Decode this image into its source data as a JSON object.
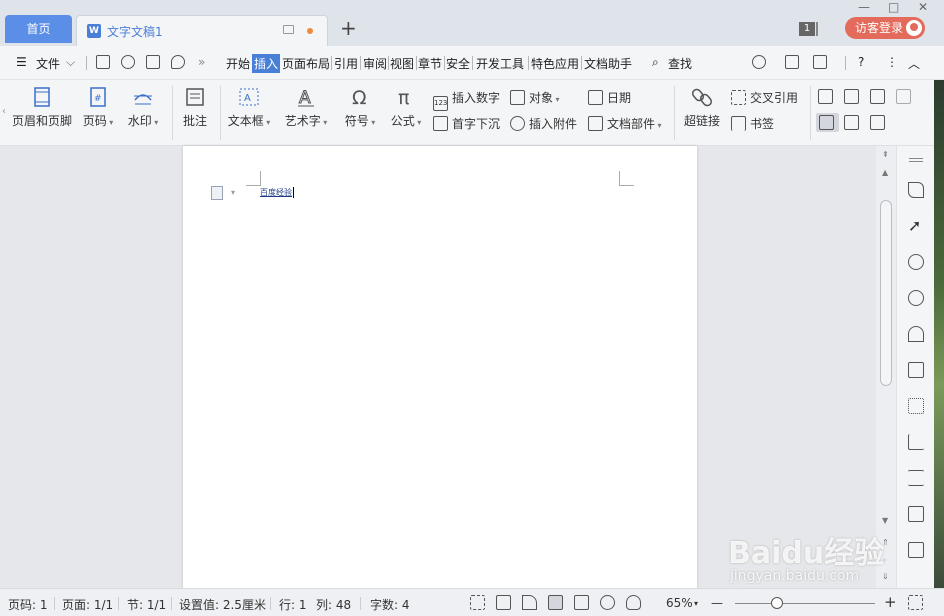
{
  "titlebar": {
    "home_tab": "首页",
    "doc_tab": "文字文稿1",
    "new_tab": "+",
    "minimize": "—",
    "restore": "□",
    "close": "✕",
    "badge": "1",
    "login": "访客登录"
  },
  "menubar": {
    "file": "文件",
    "more": "»",
    "tabs": [
      "开始",
      "插入",
      "页面布局",
      "引用",
      "审阅",
      "视图",
      "章节",
      "安全",
      "开发工具",
      "特色应用",
      "文档助手"
    ],
    "active_tab": "插入",
    "search": "查找",
    "help": "?",
    "more_menu": "⋮",
    "collapse": "︿"
  },
  "ribbon": {
    "header_footer": "页眉和页脚",
    "page_number": "页码",
    "watermark": "水印",
    "comment": "批注",
    "textbox": "文本框",
    "wordart": "艺术字",
    "symbol": "符号",
    "formula": "公式",
    "insert_number": "插入数字",
    "drop_cap": "首字下沉",
    "object": "对象",
    "attachment": "插入附件",
    "date": "日期",
    "doc_parts": "文档部件",
    "hyperlink": "超链接",
    "cross_ref": "交叉引用",
    "bookmark": "书签"
  },
  "document": {
    "text": "百度经验"
  },
  "statusbar": {
    "page_code": "页码: 1",
    "pages": "页面: 1/1",
    "section": "节: 1/1",
    "setting": "设置值: 2.5厘米",
    "row": "行: 1",
    "col": "列: 48",
    "word_count": "字数: 4",
    "zoom": "65%",
    "zoom_out": "—",
    "zoom_in": "+"
  },
  "watermark": {
    "brand": "Baidu经验",
    "url": "jingyan.baidu.com"
  },
  "colors": {
    "accent": "#4a7fd8",
    "home_tab": "#5b8ee6",
    "login": "#e46a5c"
  }
}
